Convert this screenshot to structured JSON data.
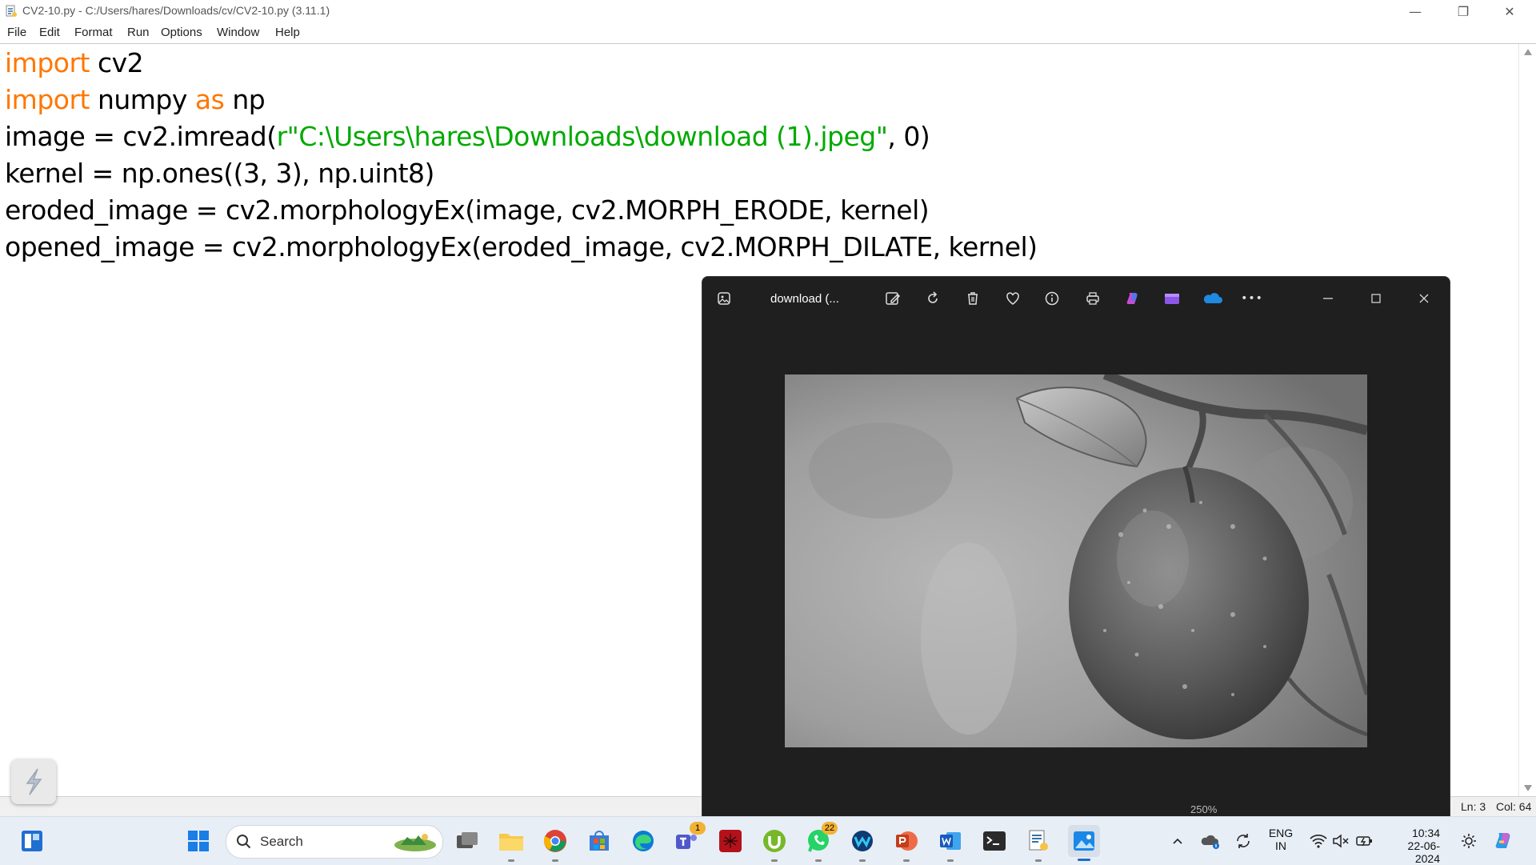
{
  "window": {
    "title": "CV2-10.py - C:/Users/hares/Downloads/cv/CV2-10.py (3.11.1)",
    "controls": {
      "minimize": "—",
      "restore": "❐",
      "close": "✕"
    }
  },
  "menu": [
    "File",
    "Edit",
    "Format",
    "Run",
    "Options",
    "Window",
    "Help"
  ],
  "code": {
    "line1": {
      "kw": "import",
      "rest": " cv2"
    },
    "line2": {
      "kw": "import",
      "mid": " numpy ",
      "kw2": "as",
      "rest": " np"
    },
    "line3": {
      "pre": "image = cv2.imread(",
      "str": "r\"C:\\Users\\hares\\Downloads\\download (1).jpeg\"",
      "post": ", 0)"
    },
    "line4": "kernel = np.ones((3, 3), np.uint8)",
    "line5": "eroded_image = cv2.morphologyEx(image, cv2.MORPH_ERODE, kernel)",
    "line6": "opened_image = cv2.morphologyEx(eroded_image, cv2.MORPH_DILATE, kernel)"
  },
  "status": {
    "ln": "Ln: 3",
    "col": "Col: 64"
  },
  "photos": {
    "title": "download (...",
    "zoom": "250%",
    "tools": [
      "edit-icon",
      "rotate-icon",
      "delete-icon",
      "favorite-icon",
      "info-icon",
      "print-icon",
      "copilot-icon",
      "clipchamp-icon",
      "onedrive-icon",
      "more-icon"
    ],
    "more": "•••"
  },
  "taskbar": {
    "search_label": "Search",
    "badges": {
      "teams": "1",
      "whatsapp": "22"
    },
    "lang_top": "ENG",
    "lang_bottom": "IN",
    "time": "10:34",
    "date": "22-06-2024"
  }
}
